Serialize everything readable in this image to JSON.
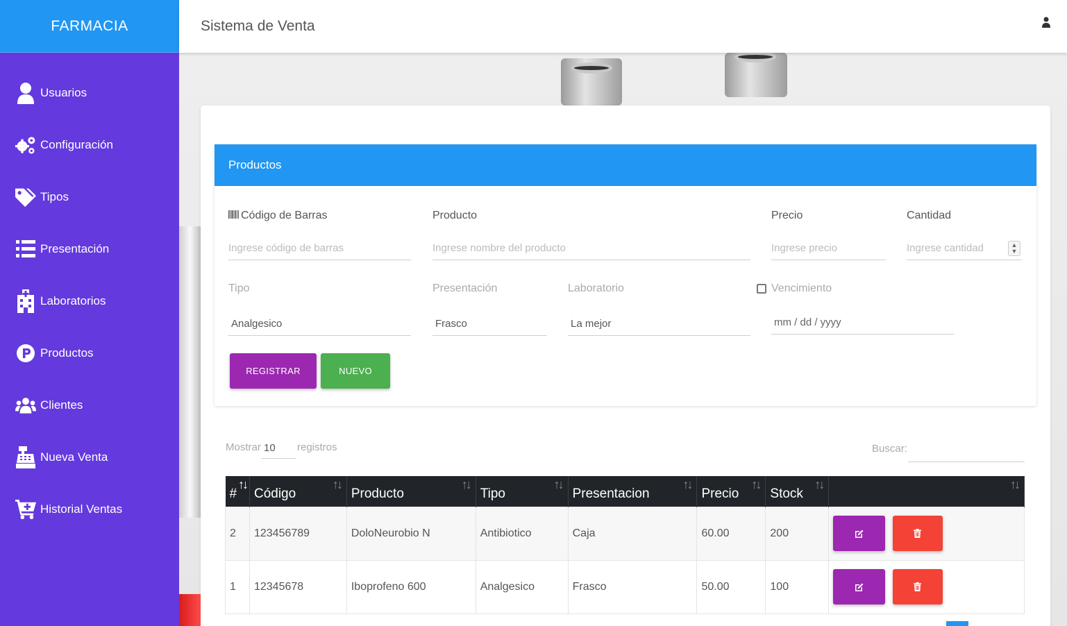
{
  "brand": "FARMACIA",
  "topbar": {
    "title": "Sistema de Venta",
    "user_icon": "user-icon"
  },
  "sidebar": {
    "items": [
      {
        "label": "Usuarios",
        "icon": "user-icon"
      },
      {
        "label": "Configuración",
        "icon": "gears-icon"
      },
      {
        "label": "Tipos",
        "icon": "tags-icon"
      },
      {
        "label": "Presentación",
        "icon": "list-icon"
      },
      {
        "label": "Laboratorios",
        "icon": "hospital-icon"
      },
      {
        "label": "Productos",
        "icon": "parking-circle-icon"
      },
      {
        "label": "Clientes",
        "icon": "users-icon"
      },
      {
        "label": "Nueva Venta",
        "icon": "cash-register-icon"
      },
      {
        "label": "Historial Ventas",
        "icon": "cart-plus-icon"
      }
    ]
  },
  "form": {
    "header": "Productos",
    "barcode_label": "Código de Barras",
    "barcode_placeholder": "Ingrese código de barras",
    "product_label": "Producto",
    "product_placeholder": "Ingrese nombre del producto",
    "price_label": "Precio",
    "price_placeholder": "Ingrese precio",
    "qty_label": "Cantidad",
    "qty_placeholder": "Ingrese cantidad",
    "tipo_label": "Tipo",
    "tipo_value": "Analgesico",
    "presentacion_label": "Presentación",
    "presentacion_value": "Frasco",
    "laboratorio_label": "Laboratorio",
    "laboratorio_value": "La mejor",
    "vencimiento_label": "Vencimiento",
    "vencimiento_checked": false,
    "date_placeholder": "mm / dd / yyyy",
    "register_label": "REGISTRAR",
    "new_label": "NUEVO"
  },
  "datatable": {
    "show_label": "Mostrar",
    "show_value": "10",
    "records_label": "registros",
    "search_label": "Buscar:",
    "search_value": ""
  },
  "table": {
    "columns": [
      "#",
      "Código",
      "Producto",
      "Tipo",
      "Presentacion",
      "Precio",
      "Stock",
      ""
    ],
    "rows": [
      {
        "id": "2",
        "codigo": "123456789",
        "producto": "DoloNeurobio N",
        "tipo": "Antibiotico",
        "presentacion": "Caja",
        "precio": "60.00",
        "stock": "200"
      },
      {
        "id": "1",
        "codigo": "12345678",
        "producto": "Iboprofeno 600",
        "tipo": "Analgesico",
        "presentacion": "Frasco",
        "precio": "50.00",
        "stock": "100"
      }
    ]
  },
  "colors": {
    "sidebar": "#6439dd",
    "primary": "#2196f3",
    "purple": "#9c27b0",
    "green": "#4caf50",
    "red": "#f44336",
    "table_head": "#212529"
  }
}
